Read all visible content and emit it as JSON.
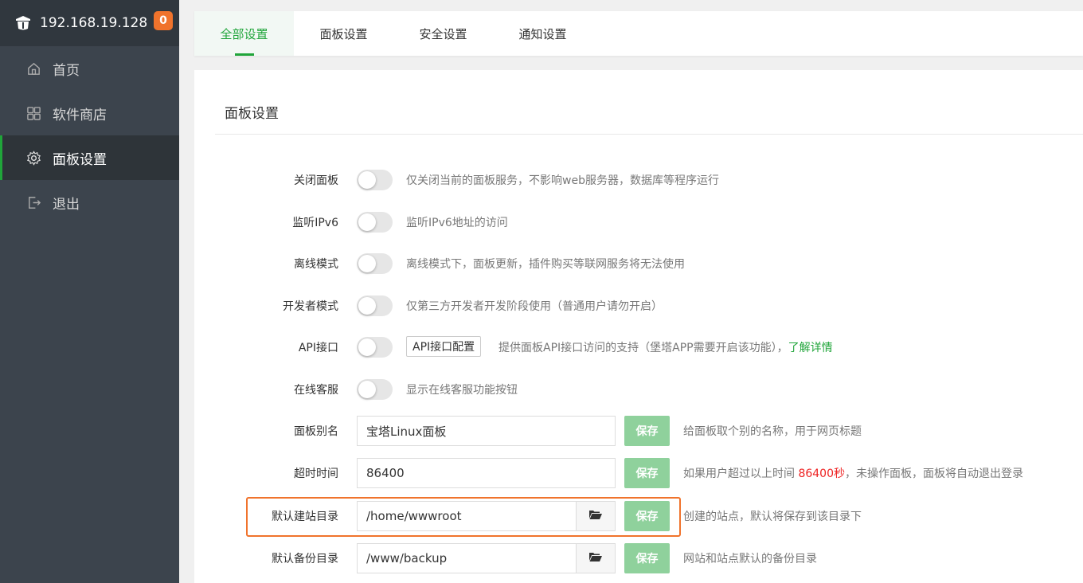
{
  "sidebar": {
    "server_ip": "192.168.19.128",
    "badge_count": "0",
    "items": [
      {
        "label": "首页",
        "icon": "home-icon"
      },
      {
        "label": "软件商店",
        "icon": "grid-icon"
      },
      {
        "label": "面板设置",
        "icon": "gear-icon"
      },
      {
        "label": "退出",
        "icon": "logout-icon"
      }
    ],
    "active_index": 2
  },
  "tabs": [
    {
      "label": "全部设置"
    },
    {
      "label": "面板设置"
    },
    {
      "label": "安全设置"
    },
    {
      "label": "通知设置"
    }
  ],
  "panel": {
    "title": "面板设置",
    "rows": {
      "close_panel": {
        "label": "关闭面板",
        "hint": "仅关闭当前的面板服务，不影响web服务器，数据库等程序运行"
      },
      "ipv6": {
        "label": "监听IPv6",
        "hint": "监听IPv6地址的访问"
      },
      "offline": {
        "label": "离线模式",
        "hint": "离线模式下，面板更新，插件购买等联网服务将无法使用"
      },
      "developer": {
        "label": "开发者模式",
        "hint": "仅第三方开发者开发阶段使用（普通用户请勿开启）"
      },
      "api": {
        "label": "API接口",
        "button": "API接口配置",
        "hint": "提供面板API接口访问的支持（堡塔APP需要开启该功能），",
        "link": "了解详情"
      },
      "support": {
        "label": "在线客服",
        "hint": "显示在线客服功能按钮"
      },
      "alias": {
        "label": "面板别名",
        "value": "宝塔Linux面板",
        "save": "保存",
        "hint": "给面板取个别的名称，用于网页标题"
      },
      "timeout": {
        "label": "超时时间",
        "value": "86400",
        "save": "保存",
        "hint_pre": "如果用户超过以上时间 ",
        "hint_value": "86400秒",
        "hint_post": "，未操作面板，面板将自动退出登录"
      },
      "site_dir": {
        "label": "默认建站目录",
        "value": "/home/wwwroot",
        "save": "保存",
        "hint": "创建的站点，默认将保存到该目录下"
      },
      "backup_dir": {
        "label": "默认备份目录",
        "value": "/www/backup",
        "save": "保存",
        "hint": "网站和站点默认的备份目录"
      }
    }
  },
  "colors": {
    "accent": "#20a53a",
    "highlight": "#f0732c",
    "sidebar_bg": "#3c444d"
  }
}
